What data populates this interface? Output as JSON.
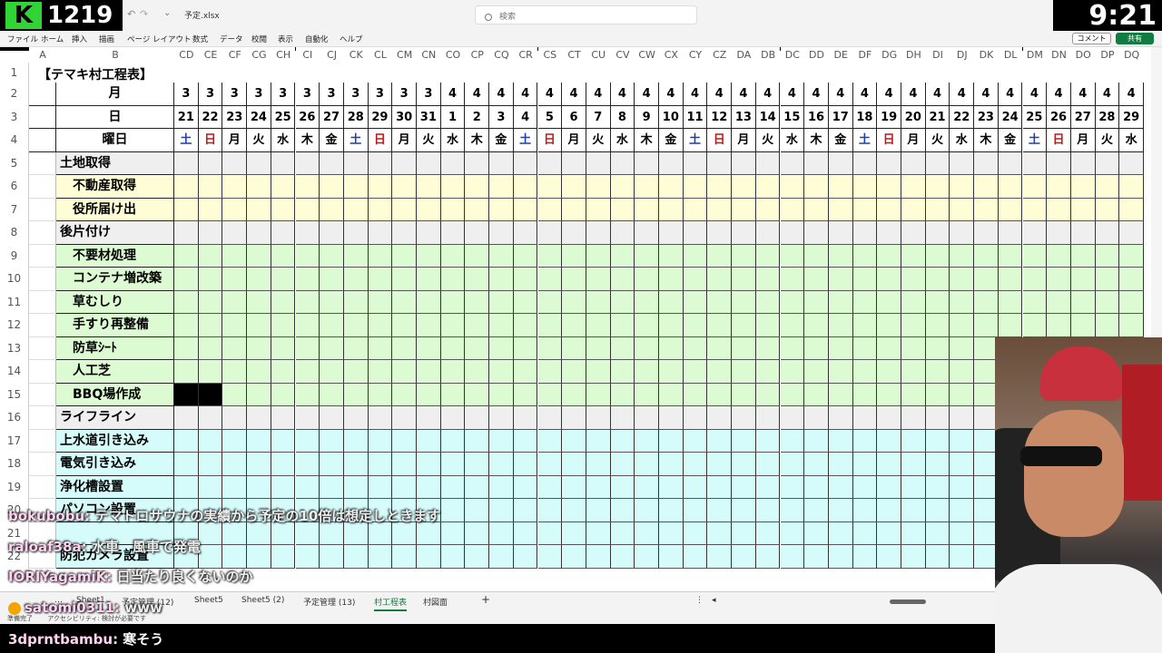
{
  "app": {
    "channel_badge": "1219",
    "filename": "予定.xlsx",
    "search_placeholder": "検索",
    "clock": "9:21"
  },
  "menu": [
    "ファイル",
    "ホーム",
    "挿入",
    "描画",
    "ページ レイアウト",
    "数式",
    "データ",
    "校閲",
    "表示",
    "自動化",
    "ヘルプ"
  ],
  "buttons": {
    "comment": "コメント",
    "share": "共有"
  },
  "columns": [
    "A",
    "B",
    "CD",
    "CE",
    "CF",
    "CG",
    "CH",
    "CI",
    "CJ",
    "CK",
    "CL",
    "CM",
    "CN",
    "CO",
    "CP",
    "CQ",
    "CR",
    "CS",
    "CT",
    "CU",
    "CV",
    "CW",
    "CX",
    "CY",
    "CZ",
    "DA",
    "DB",
    "DC",
    "DD",
    "DE",
    "DF",
    "DG",
    "DH",
    "DI",
    "DJ",
    "DK",
    "DL",
    "DM",
    "DN",
    "DO",
    "DP",
    "DQ"
  ],
  "rows": [
    "1",
    "2",
    "3",
    "4",
    "5",
    "6",
    "7",
    "8",
    "9",
    "10",
    "11",
    "12",
    "13",
    "14",
    "15",
    "16",
    "17",
    "18",
    "19",
    "20",
    "21",
    "22"
  ],
  "sheet": {
    "title": "【テマキ村工程表】",
    "month_label": "月",
    "day_label": "日",
    "weekday_label": "曜日",
    "months": [
      "3",
      "3",
      "3",
      "3",
      "3",
      "3",
      "3",
      "3",
      "3",
      "3",
      "3",
      "4",
      "4",
      "4",
      "4",
      "4",
      "4",
      "4",
      "4",
      "4",
      "4",
      "4",
      "4",
      "4",
      "4",
      "4",
      "4",
      "4",
      "4",
      "4",
      "4",
      "4",
      "4",
      "4",
      "4",
      "4",
      "4",
      "4",
      "4",
      "4"
    ],
    "days": [
      "21",
      "22",
      "23",
      "24",
      "25",
      "26",
      "27",
      "28",
      "29",
      "30",
      "31",
      "1",
      "2",
      "3",
      "4",
      "5",
      "6",
      "7",
      "8",
      "9",
      "10",
      "11",
      "12",
      "13",
      "14",
      "15",
      "16",
      "17",
      "18",
      "19",
      "20",
      "21",
      "22",
      "23",
      "24",
      "25",
      "26",
      "27",
      "28",
      "29"
    ],
    "weekdays": [
      "土",
      "日",
      "月",
      "火",
      "水",
      "木",
      "金",
      "土",
      "日",
      "月",
      "火",
      "水",
      "木",
      "金",
      "土",
      "日",
      "月",
      "火",
      "水",
      "木",
      "金",
      "土",
      "日",
      "月",
      "火",
      "水",
      "木",
      "金",
      "土",
      "日",
      "月",
      "火",
      "水",
      "木",
      "金",
      "土",
      "日",
      "月",
      "火",
      "水"
    ],
    "tasks": [
      {
        "label": "土地取得",
        "indent": 0
      },
      {
        "label": "不動産取得",
        "indent": 1
      },
      {
        "label": "役所届け出",
        "indent": 1
      },
      {
        "label": "後片付け",
        "indent": 0
      },
      {
        "label": "不要材処理",
        "indent": 1
      },
      {
        "label": "コンテナ増改築",
        "indent": 1
      },
      {
        "label": "草むしり",
        "indent": 1
      },
      {
        "label": "手すり再整備",
        "indent": 1
      },
      {
        "label": "防草ｼｰﾄ",
        "indent": 1
      },
      {
        "label": "人工芝",
        "indent": 1
      },
      {
        "label": "BBQ場作成",
        "indent": 1
      },
      {
        "label": "ライフライン",
        "indent": 0
      },
      {
        "label": "上水道引き込み",
        "indent": 0
      },
      {
        "label": "電気引き込み",
        "indent": 0
      },
      {
        "label": "浄化槽設置",
        "indent": 0
      },
      {
        "label": "パソコン設置",
        "indent": 0
      },
      {
        "label": "",
        "indent": 0
      },
      {
        "label": "防犯カメラ設置",
        "indent": 0
      }
    ]
  },
  "colors": {
    "section_gray": "#efefef",
    "section1": "#fffdd6",
    "section2": "#ddfbd2",
    "section3": "#d6fbfb",
    "saturday": "#1a3fb8",
    "sunday": "#c01818",
    "excel_green": "#107c41"
  },
  "sheet_tabs": [
    "Sheet1",
    "予定管理 (12)",
    "Sheet5",
    "Sheet5 (2)",
    "予定管理 (13)",
    "村工程表",
    "村図面"
  ],
  "active_tab": "村工程表",
  "status": {
    "ready": "準備完了",
    "accessibility": "アクセシビリティ: 検討が必要です"
  },
  "chat": [
    {
      "user": "bokubobu:",
      "text": " テマトロサウナの実績から予定の10倍は想定しときます"
    },
    {
      "user": "raloaf38a:",
      "text": " 水車　風車で発電"
    },
    {
      "user": "IORIYagamiK:",
      "text": " 日当たり良くないのか"
    },
    {
      "user": "satomi0311:",
      "text": " www"
    },
    {
      "user": "3dprntbambu:",
      "text": " 寒そう"
    }
  ]
}
